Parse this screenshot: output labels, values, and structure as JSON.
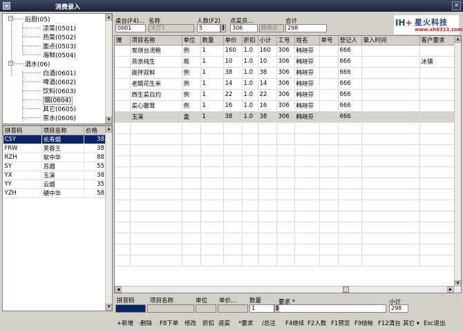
{
  "window": {
    "title": "消费录入",
    "close": "×"
  },
  "tree": {
    "nodes": [
      {
        "label": "后厨(05)",
        "level": 1,
        "expanded": true
      },
      {
        "label": "凉菜(0501)",
        "level": 2
      },
      {
        "label": "热菜(0502)",
        "level": 2
      },
      {
        "label": "面点(0503)",
        "level": 2
      },
      {
        "label": "海鲜(0504)",
        "level": 2
      },
      {
        "label": "酒水(06)",
        "level": 1,
        "expanded": true
      },
      {
        "label": "白酒(0601)",
        "level": 2
      },
      {
        "label": "啤酒(0602)",
        "level": 2
      },
      {
        "label": "饮料(0603)",
        "level": 2
      },
      {
        "label": "烟(0604)",
        "level": 2,
        "selected": true
      },
      {
        "label": "其它(0605)",
        "level": 2
      },
      {
        "label": "茶水(0606)",
        "level": 2
      }
    ]
  },
  "item_list": {
    "headers": [
      "拼音码",
      "项目名称",
      "价格"
    ],
    "rows": [
      [
        "CSY",
        "长寿烟",
        "38"
      ],
      [
        "FRW",
        "芙蓉王",
        "38"
      ],
      [
        "RZH",
        "软中华",
        "88"
      ],
      [
        "SY",
        "苏烟",
        "55"
      ],
      [
        "YX",
        "玉溪",
        "38"
      ],
      [
        "YY",
        "云烟",
        "35"
      ],
      [
        "YZH",
        "硬中华",
        "58"
      ]
    ],
    "selected_index": 0
  },
  "header_fields": {
    "table_label": "桌台(F4)...",
    "table_value": "0001",
    "name_label": "名称",
    "name_value": "大厅1",
    "people_label": "人数(F2)",
    "people_value": "5",
    "waiter_label": "点菜员...",
    "waiter_code": "306",
    "waiter_name": "韩晓芬",
    "total_label": "合计",
    "total_value": "298"
  },
  "logo": {
    "mark_blue": "IH",
    "mark_red": "+",
    "name": "星火科技",
    "url": "www.xh0311.com"
  },
  "grid": {
    "headers": [
      "赠",
      "项目名称",
      "单位",
      "数量",
      "单价",
      "折扣",
      "小计",
      "工号",
      "姓名",
      "单号",
      "登记人",
      "录入时间",
      "客户要求"
    ],
    "rows": [
      [
        "",
        "炭烧台湾鲍",
        "例",
        "1",
        "160",
        "1.0",
        "160",
        "306",
        "韩晓芬",
        "",
        "666",
        "",
        ""
      ],
      [
        "",
        "燕京纯生",
        "瓶",
        "1",
        "10",
        "1.0",
        "10",
        "306",
        "韩晓芬",
        "",
        "666",
        "",
        "冰镇"
      ],
      [
        "",
        "拨拌双鲜",
        "例",
        "1",
        "38",
        "1.0",
        "38",
        "306",
        "韩晓芬",
        "",
        "666",
        "",
        ""
      ],
      [
        "",
        "老醋花生米",
        "例",
        "1",
        "14",
        "1.0",
        "14",
        "306",
        "韩晓芬",
        "",
        "666",
        "",
        ""
      ],
      [
        "",
        "西生菜白灼",
        "例",
        "1",
        "22",
        "1.0",
        "22",
        "306",
        "韩晓芬",
        "",
        "666",
        "",
        ""
      ],
      [
        "",
        "菜心藤茸",
        "例",
        "1",
        "16",
        "1.0",
        "16",
        "306",
        "韩晓芬",
        "",
        "666",
        "",
        ""
      ],
      [
        "",
        "玉溪",
        "盒",
        "1",
        "38",
        "1.0",
        "38",
        "306",
        "韩晓芬",
        "",
        "666",
        "",
        ""
      ]
    ],
    "selected_index": 6
  },
  "entry": {
    "pinyin_label": "拼音码",
    "item_label": "项目名称",
    "unit_label": "单位",
    "price_label": "单价...",
    "qty_label": "数量",
    "qty_value": "1",
    "req_label": "要求 *",
    "subtotal_label": "小计",
    "subtotal_value": "298"
  },
  "shortcuts": [
    "+新增",
    "-删除",
    "F8下单",
    "修改",
    "折扣",
    "退菜",
    "*要求",
    "/总注",
    "F4继续",
    "F2人数",
    "F1预览",
    "F9结帐",
    "F12清台",
    "其它 ▾",
    "Esc退出"
  ]
}
